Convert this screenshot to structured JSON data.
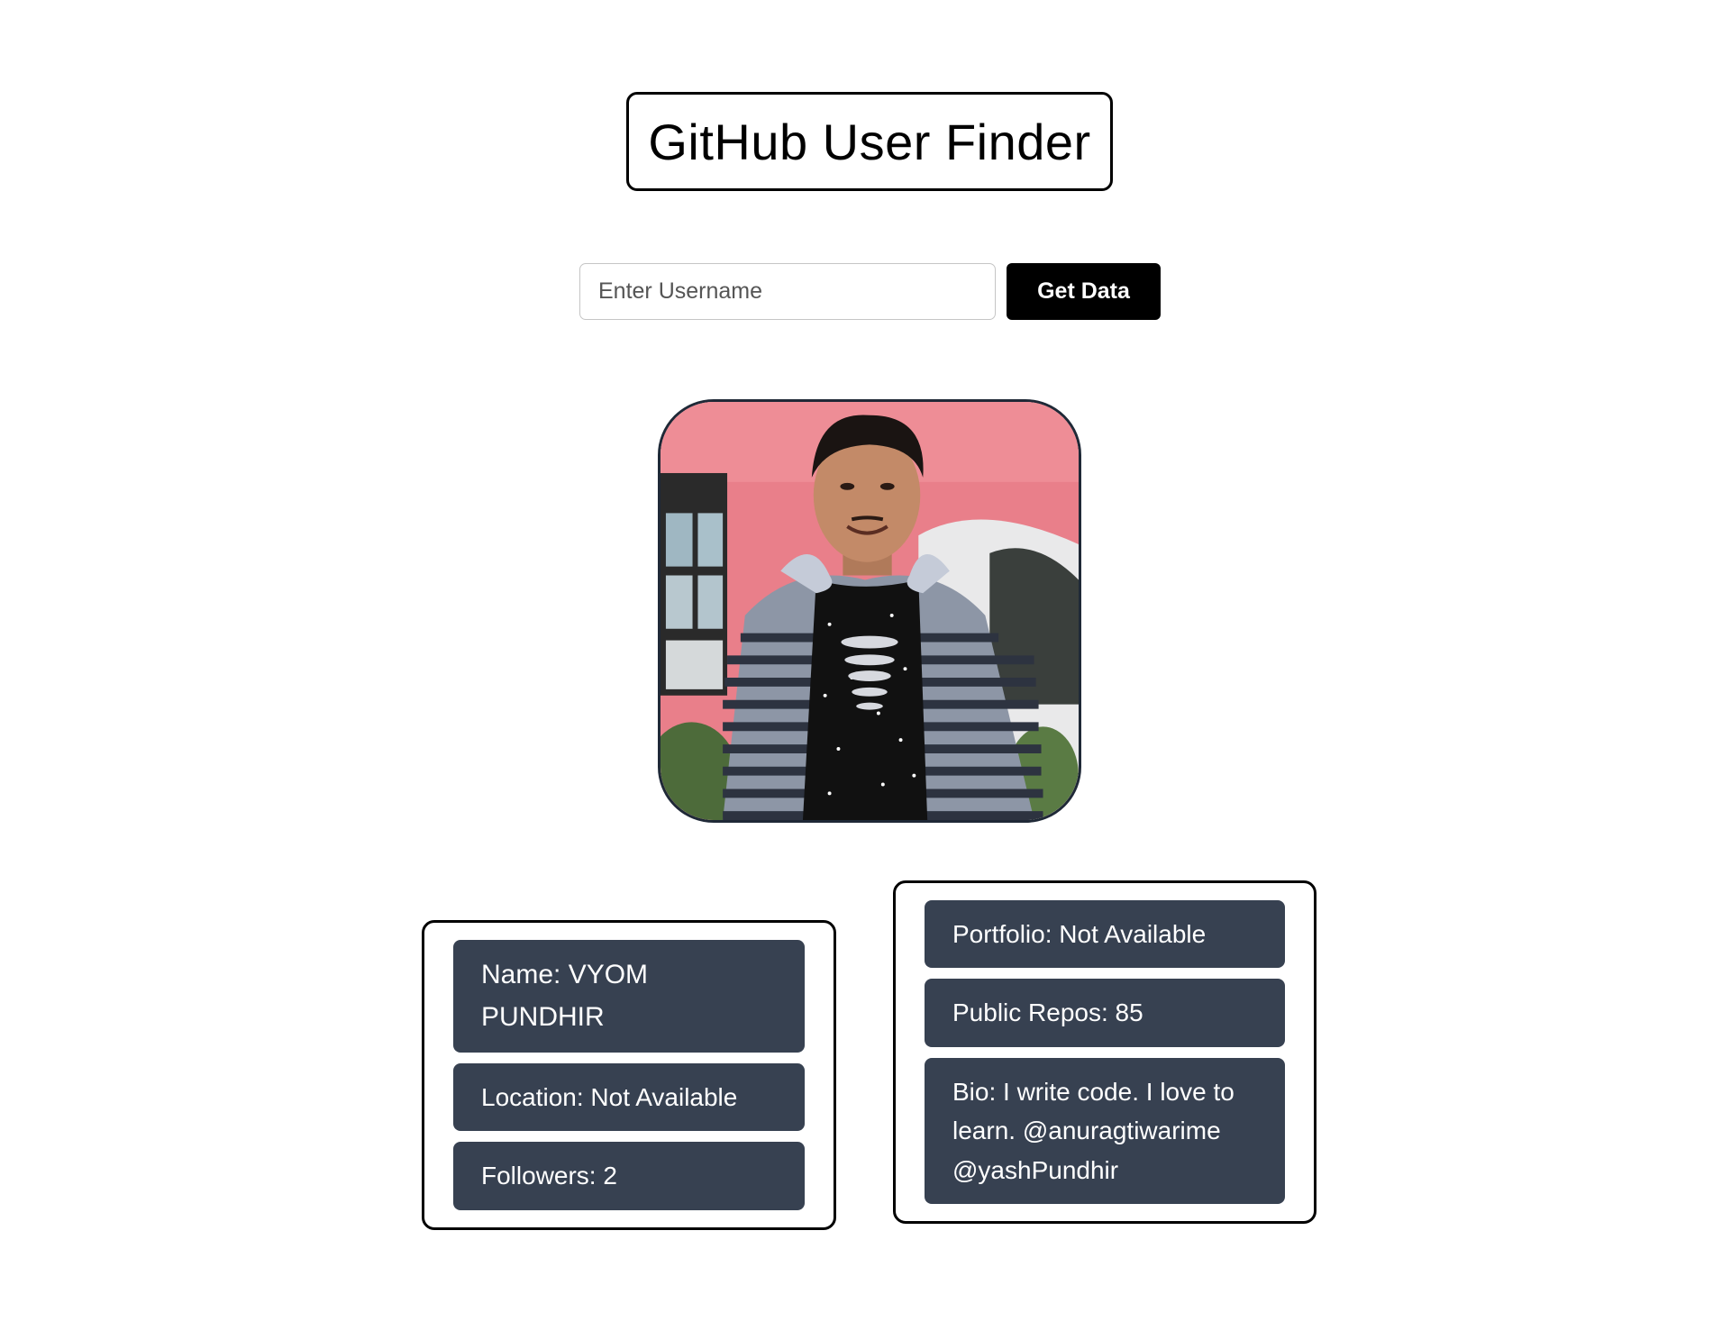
{
  "header": {
    "title": "GitHub User Finder"
  },
  "search": {
    "placeholder": "Enter Username",
    "value": "",
    "button_label": "Get Data"
  },
  "profile": {
    "avatar_description": "profile-photo",
    "left_card": {
      "name": "Name: VYOM PUNDHIR",
      "location": "Location: Not Available",
      "followers": "Followers: 2"
    },
    "right_card": {
      "portfolio": "Portfolio: Not Available",
      "public_repos": "Public Repos: 85",
      "bio": "Bio: I write code. I love to learn. @anuragtiwarime @yashPundhir"
    }
  },
  "colors": {
    "pill_background": "#374151",
    "button_background": "#000000",
    "border": "#000000"
  }
}
